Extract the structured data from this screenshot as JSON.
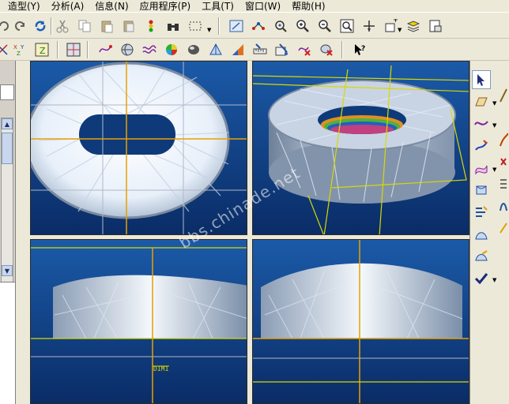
{
  "menubar": {
    "items": [
      "造型(Y)",
      "分析(A)",
      "信息(N)",
      "应用程序(P)",
      "工具(T)",
      "窗口(W)",
      "帮助(H)"
    ]
  },
  "viewport": {
    "dimension_label": "DIM1",
    "watermark": "bbs.chinade.net"
  },
  "colors": {
    "viewport_top": "#1b5aa8",
    "viewport_bottom": "#0a2c66",
    "grid_line": "#b0b8c8",
    "axis_line": "#e8a000",
    "frame_line": "#d8d800",
    "ui_background": "#ece9d8"
  },
  "toolbar_icons": {
    "row1": [
      "undo-icon",
      "redo-icon",
      "refresh-icon",
      "cut-icon",
      "copy-icon",
      "paste-icon",
      "paste-special-icon",
      "traffic-light-icon",
      "binoculars-icon",
      "select-box-icon",
      "view-fit-icon",
      "node-icon",
      "snap-icon",
      "zoom-in-icon",
      "zoom-out-icon",
      "zoom-window-icon",
      "pan-icon",
      "layer-add-icon",
      "layers-icon",
      "camera-icon"
    ],
    "row2": [
      "axis-icon",
      "xyz-icon",
      "z-align-icon",
      "grid-icon",
      "curve-icon",
      "sphere-icon",
      "wave-icon",
      "color-map-icon",
      "shade-icon",
      "prism-icon",
      "gradient-icon",
      "measure-icon",
      "section-icon",
      "probe-icon",
      "delete-curve-icon",
      "delete-surface-icon",
      "help-arrow-icon"
    ]
  },
  "right_tools": [
    "select-arrow-icon",
    "plane-icon",
    "curve-tool-icon",
    "sketch-icon",
    "surface-icon",
    "sweep-icon",
    "blend-icon",
    "patch-icon",
    "trim-icon",
    "confirm-check-icon"
  ]
}
